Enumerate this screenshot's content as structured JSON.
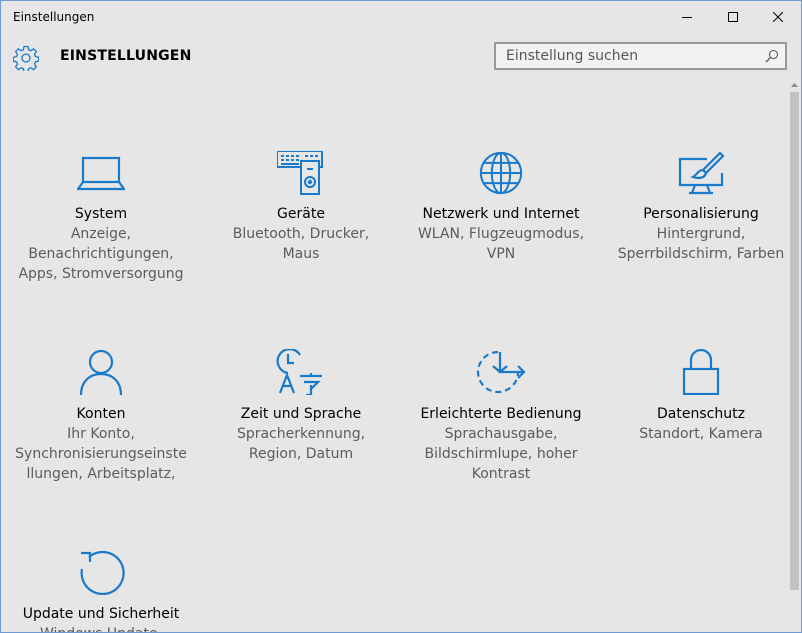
{
  "window": {
    "title": "Einstellungen",
    "controls": [
      "minimize",
      "maximize",
      "close"
    ]
  },
  "header": {
    "title": "EINSTELLUNGEN",
    "icon": "gear-icon"
  },
  "search": {
    "placeholder": "Einstellung suchen",
    "value": "",
    "icon": "search-icon"
  },
  "accent_color": "#1979ca",
  "tiles": [
    {
      "title": "System",
      "desc": [
        "Anzeige,",
        "Benachrichtigungen,",
        "Apps, Stromversorgung"
      ],
      "icon": "laptop-icon"
    },
    {
      "title": "Geräte",
      "desc": [
        "Bluetooth, Drucker,",
        "Maus"
      ],
      "icon": "devices-icon"
    },
    {
      "title": "Netzwerk und Internet",
      "desc": [
        "WLAN, Flugzeugmodus,",
        "VPN"
      ],
      "icon": "globe-icon"
    },
    {
      "title": "Personalisierung",
      "desc": [
        "Hintergrund,",
        "Sperrbildschirm, Farben"
      ],
      "icon": "paint-brush-icon"
    },
    {
      "title": "Konten",
      "desc": [
        "Ihr Konto,",
        "Synchronisierungseinste",
        "llungen, Arbeitsplatz,"
      ],
      "icon": "user-icon"
    },
    {
      "title": "Zeit und Sprache",
      "desc": [
        "Spracherkennung,",
        "Region, Datum"
      ],
      "icon": "clock-language-icon"
    },
    {
      "title": "Erleichterte Bedienung",
      "desc": [
        "Sprachausgabe,",
        "Bildschirmlupe, hoher",
        "Kontrast"
      ],
      "icon": "ease-of-access-icon"
    },
    {
      "title": "Datenschutz",
      "desc": [
        "Standort, Kamera"
      ],
      "icon": "lock-icon"
    },
    {
      "title": "Update und Sicherheit",
      "desc": [
        "Windows Update,"
      ],
      "icon": "refresh-icon"
    }
  ]
}
